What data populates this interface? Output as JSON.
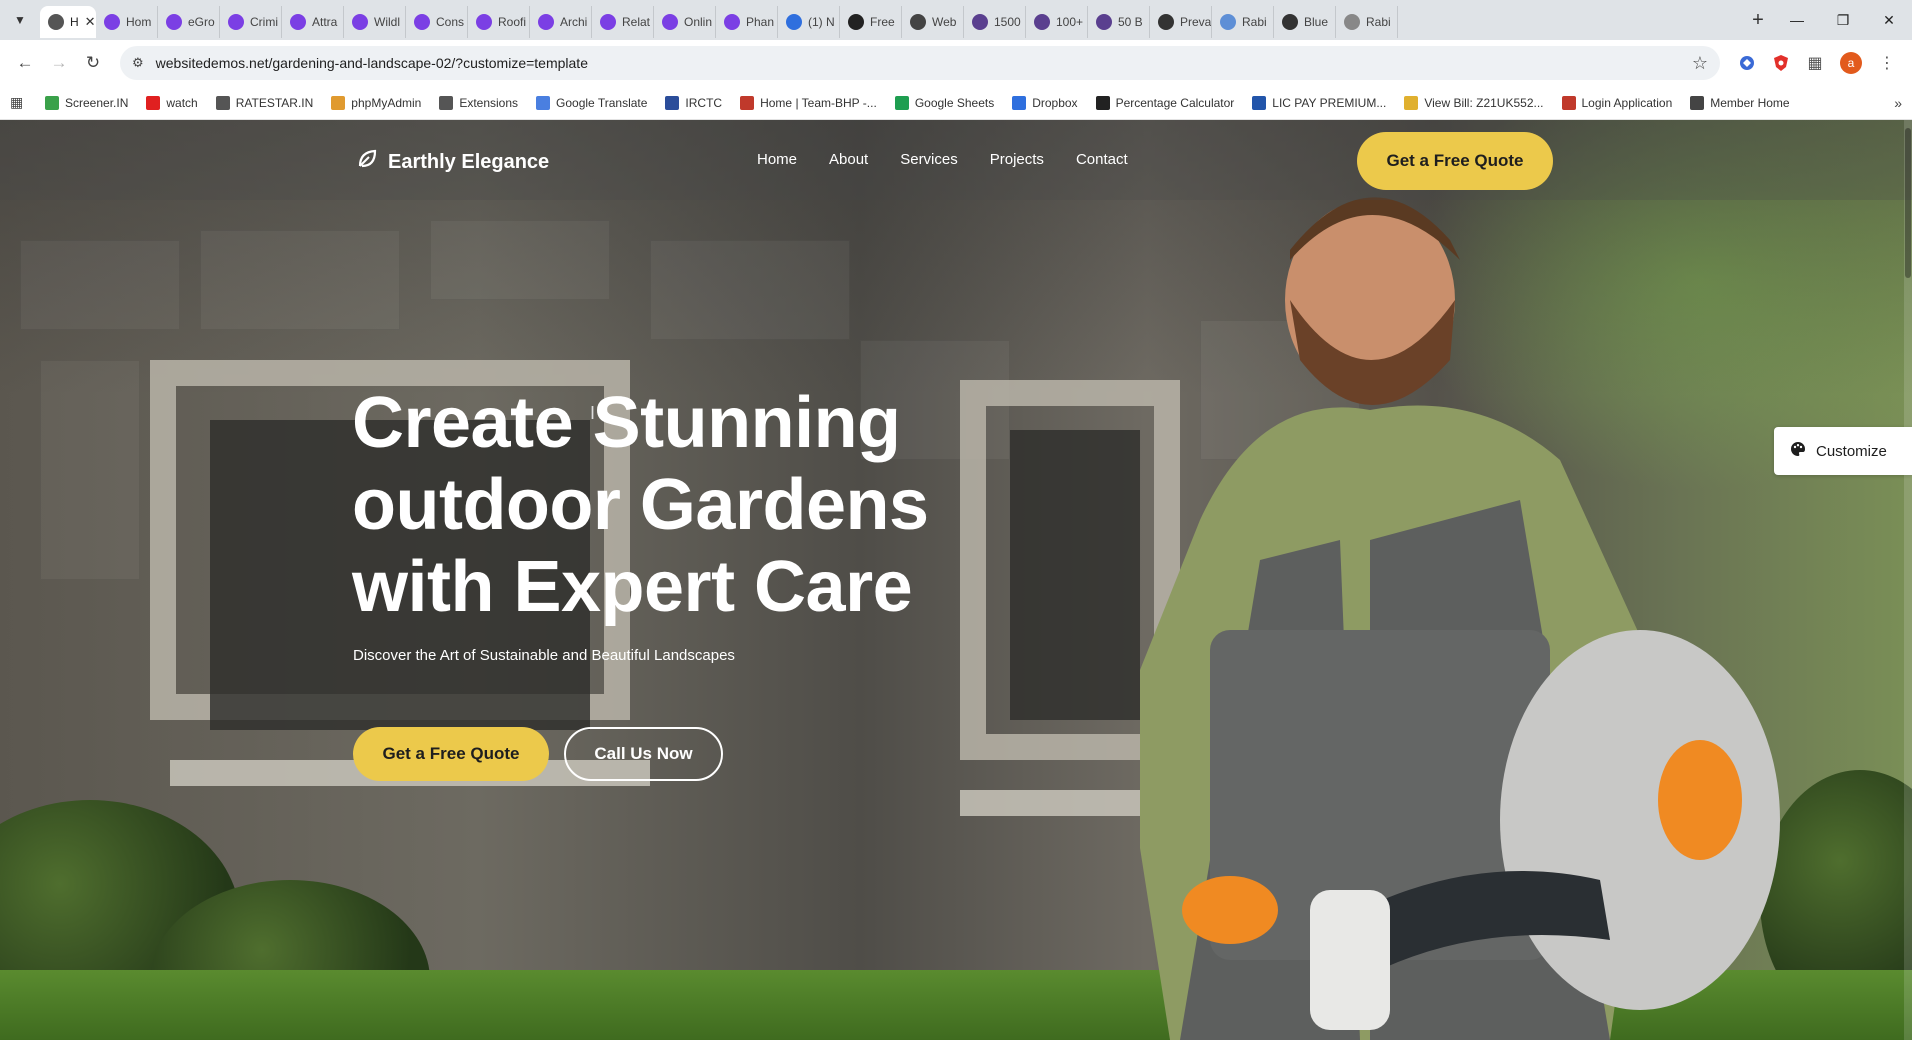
{
  "browser": {
    "tabs": [
      {
        "label": "H",
        "color": "#555555",
        "active": true
      },
      {
        "label": "Hom",
        "color": "#7b3fe4"
      },
      {
        "label": "eGro",
        "color": "#7b3fe4"
      },
      {
        "label": "Crimi",
        "color": "#7b3fe4"
      },
      {
        "label": "Attra",
        "color": "#7b3fe4"
      },
      {
        "label": "Wildl",
        "color": "#7b3fe4"
      },
      {
        "label": "Cons",
        "color": "#7b3fe4"
      },
      {
        "label": "Roofi",
        "color": "#7b3fe4"
      },
      {
        "label": "Archi",
        "color": "#7b3fe4"
      },
      {
        "label": "Relat",
        "color": "#7b3fe4"
      },
      {
        "label": "Onlin",
        "color": "#7b3fe4"
      },
      {
        "label": "Phan",
        "color": "#7b3fe4"
      },
      {
        "label": "(1) N",
        "color": "#2f6fde"
      },
      {
        "label": "Free",
        "color": "#222222"
      },
      {
        "label": "Web",
        "color": "#444444"
      },
      {
        "label": "1500",
        "color": "#5a3f8f"
      },
      {
        "label": "100+",
        "color": "#5a3f8f"
      },
      {
        "label": "50 B",
        "color": "#5a3f8f"
      },
      {
        "label": "Preva",
        "color": "#333333"
      },
      {
        "label": "Rabi",
        "color": "#5e8fd6"
      },
      {
        "label": "Blue",
        "color": "#333333"
      },
      {
        "label": "Rabi",
        "color": "#888888"
      }
    ],
    "new_tab": "+",
    "url": "websitedemos.net/gardening-and-landscape-02/?customize=template",
    "profile_initial": "a",
    "bookmarks": [
      {
        "label": "Screener.IN",
        "color": "#3aa14a"
      },
      {
        "label": "watch",
        "color": "#e02020"
      },
      {
        "label": "RATESTAR.IN",
        "color": "#555555"
      },
      {
        "label": "phpMyAdmin",
        "color": "#e09a2f"
      },
      {
        "label": "Extensions",
        "color": "#555555"
      },
      {
        "label": "Google Translate",
        "color": "#4a7fe0"
      },
      {
        "label": "IRCTC",
        "color": "#2b4d9a"
      },
      {
        "label": "Home | Team-BHP -...",
        "color": "#c0392b"
      },
      {
        "label": "Google Sheets",
        "color": "#1e9e50"
      },
      {
        "label": "Dropbox",
        "color": "#2f6fde"
      },
      {
        "label": "Percentage Calculator",
        "color": "#222222"
      },
      {
        "label": "LIC PAY PREMIUM...",
        "color": "#2255aa"
      },
      {
        "label": "View Bill: Z21UK552...",
        "color": "#e0b02f"
      },
      {
        "label": "Login Application",
        "color": "#c0392b"
      },
      {
        "label": "Member Home",
        "color": "#444444"
      }
    ]
  },
  "site": {
    "brand": "Earthly Elegance",
    "nav": [
      "Home",
      "About",
      "Services",
      "Projects",
      "Contact"
    ],
    "header_cta": "Get a Free Quote",
    "hero": {
      "title_line1": "Create Stunning",
      "title_line2": "outdoor Gardens",
      "title_line3": "with Expert Care",
      "subtitle": "Discover the Art of Sustainable and Beautiful Landscapes",
      "primary_cta": "Get a Free Quote",
      "secondary_cta": "Call Us Now"
    },
    "customize_label": "Customize",
    "accent_color": "#ecc94b"
  }
}
